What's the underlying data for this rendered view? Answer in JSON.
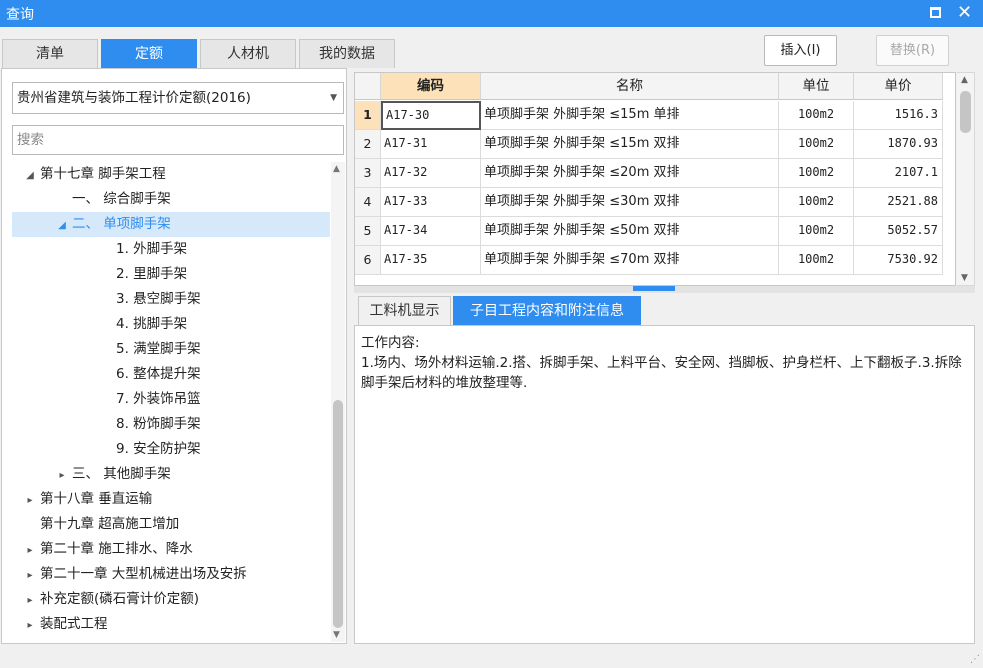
{
  "window": {
    "title": "查询"
  },
  "tabs": [
    {
      "label": "清单"
    },
    {
      "label": "定额"
    },
    {
      "label": "人材机"
    },
    {
      "label": "我的数据"
    }
  ],
  "toolbar": {
    "insert_label": "插入(I)",
    "replace_label": "替换(R)"
  },
  "left": {
    "dropdown_value": "贵州省建筑与装饰工程计价定额(2016)",
    "search_placeholder": "搜索",
    "tree": [
      {
        "toggle": "◢",
        "label": "第十七章 脚手架工程",
        "indent": 0
      },
      {
        "toggle": "",
        "label": "一、 综合脚手架",
        "indent": 1
      },
      {
        "toggle": "◢",
        "label": "二、 单项脚手架",
        "indent": 1
      },
      {
        "toggle": "",
        "label": "1. 外脚手架",
        "indent": 2
      },
      {
        "toggle": "",
        "label": "2. 里脚手架",
        "indent": 2
      },
      {
        "toggle": "",
        "label": "3. 悬空脚手架",
        "indent": 2
      },
      {
        "toggle": "",
        "label": "4. 挑脚手架",
        "indent": 2
      },
      {
        "toggle": "",
        "label": "5. 满堂脚手架",
        "indent": 2
      },
      {
        "toggle": "",
        "label": "6. 整体提升架",
        "indent": 2
      },
      {
        "toggle": "",
        "label": "7. 外装饰吊篮",
        "indent": 2
      },
      {
        "toggle": "",
        "label": "8. 粉饰脚手架",
        "indent": 2
      },
      {
        "toggle": "",
        "label": "9. 安全防护架",
        "indent": 2
      },
      {
        "toggle": "▸",
        "label": "三、 其他脚手架",
        "indent": 1
      },
      {
        "toggle": "▸",
        "label": "第十八章 垂直运输",
        "indent": 0
      },
      {
        "toggle": "",
        "label": "第十九章 超高施工增加",
        "indent": 0
      },
      {
        "toggle": "▸",
        "label": "第二十章 施工排水、降水",
        "indent": 0
      },
      {
        "toggle": "▸",
        "label": "第二十一章 大型机械进出场及安拆",
        "indent": 0
      },
      {
        "toggle": "▸",
        "label": "补充定额(磷石膏计价定额)",
        "indent": 0
      },
      {
        "toggle": "▸",
        "label": "装配式工程",
        "indent": 0
      }
    ]
  },
  "grid": {
    "headers": {
      "code": "编码",
      "name": "名称",
      "unit": "单位",
      "price": "单价"
    },
    "rows": [
      {
        "num": "1",
        "code": "A17-30",
        "name": "单项脚手架 外脚手架 ≤15m 单排",
        "unit": "100m2",
        "price": "1516.3"
      },
      {
        "num": "2",
        "code": "A17-31",
        "name": "单项脚手架 外脚手架 ≤15m 双排",
        "unit": "100m2",
        "price": "1870.93"
      },
      {
        "num": "3",
        "code": "A17-32",
        "name": "单项脚手架 外脚手架 ≤20m 双排",
        "unit": "100m2",
        "price": "2107.1"
      },
      {
        "num": "4",
        "code": "A17-33",
        "name": "单项脚手架 外脚手架 ≤30m 双排",
        "unit": "100m2",
        "price": "2521.88"
      },
      {
        "num": "5",
        "code": "A17-34",
        "name": "单项脚手架 外脚手架 ≤50m 双排",
        "unit": "100m2",
        "price": "5052.57"
      },
      {
        "num": "6",
        "code": "A17-35",
        "name": "单项脚手架 外脚手架 ≤70m 双排",
        "unit": "100m2",
        "price": "7530.92"
      }
    ]
  },
  "subtabs": [
    {
      "label": "工料机显示"
    },
    {
      "label": "子目工程内容和附注信息"
    }
  ],
  "info": {
    "heading": "工作内容:",
    "text": "1.场内、场外材料运输.2.搭、拆脚手架、上料平台、安全网、挡脚板、护身栏杆、上下翻板子.3.拆除脚手架后材料的堆放整理等."
  }
}
